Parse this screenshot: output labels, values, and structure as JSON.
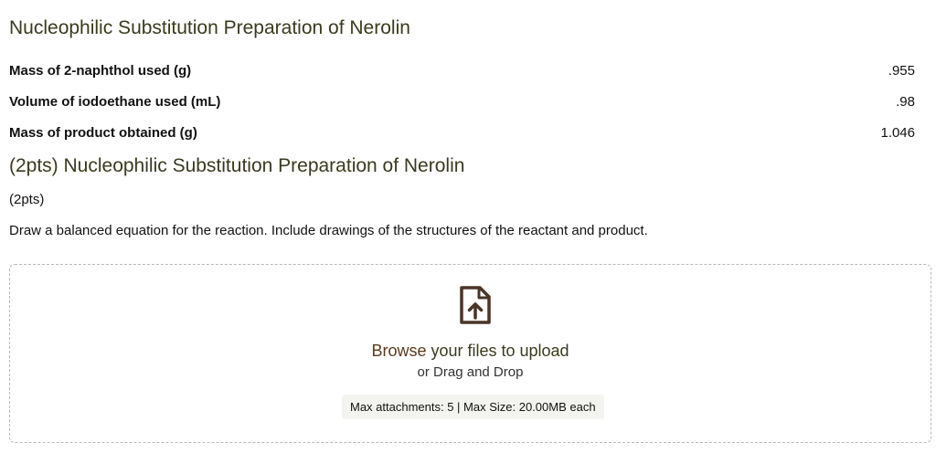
{
  "section1": {
    "title": "Nucleophilic Substitution Preparation of Nerolin",
    "rows": [
      {
        "label": "Mass of 2-naphthol used (g)",
        "value": ".955"
      },
      {
        "label": "Volume of iodoethane used (mL)",
        "value": ".98"
      },
      {
        "label": "Mass of product obtained (g)",
        "value": "1.046"
      }
    ]
  },
  "section2": {
    "title": "(2pts) Nucleophilic Substitution Preparation of Nerolin",
    "points": "(2pts)",
    "prompt": "Draw a balanced equation for the reaction. Include drawings of the structures of the reactant and product."
  },
  "upload": {
    "icon": "file-upload-icon",
    "browse_link": "Browse",
    "browse_rest": " your files to upload",
    "drag_text": "or Drag and Drop",
    "limits": "Max attachments: 5 | Max Size: 20.00MB each"
  },
  "colors": {
    "title": "#3b3a1e",
    "accent": "#5a3a1e",
    "icon": "#4a3526"
  }
}
